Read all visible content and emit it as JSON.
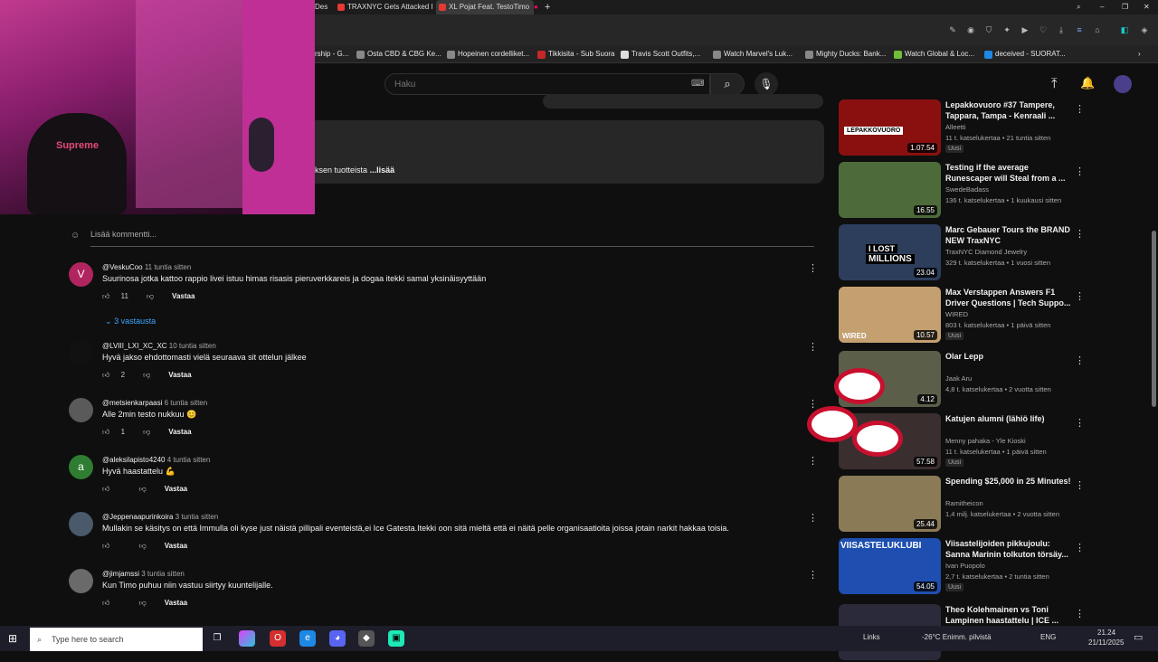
{
  "browser": {
    "tabs": [
      {
        "label": "Des"
      },
      {
        "label": "TRAXNYC Gets Attacked I"
      },
      {
        "label": "XL Pojat Feat. TestoTimo"
      }
    ],
    "bookmarks": [
      {
        "label": "rship - G..."
      },
      {
        "label": "Osta CBD & CBG Ke..."
      },
      {
        "label": "Hopeinen cordelliket..."
      },
      {
        "label": "Tikkisita - Sub Suora"
      },
      {
        "label": "Travis Scott Outfits,..."
      },
      {
        "label": "Watch Marvel's Luk..."
      },
      {
        "label": "Mighty Ducks: Bank..."
      },
      {
        "label": "Watch Global & Loc..."
      },
      {
        "label": "deceived - SUORAT..."
      }
    ]
  },
  "youtube": {
    "search_placeholder": "Haku",
    "description_snippet": "ksen tuotteista",
    "description_more": "...lisää",
    "add_comment_placeholder": "Lisää kommentti...",
    "replies_link": "3 vastausta",
    "reply_label": "Vastaa",
    "comments": [
      {
        "author": "@VeskuCoo",
        "time": "11 tuntia sitten",
        "text": "Suurinosa jotka kattoo rappio livei istuu himas risasis pieruverkkareis ja dogaa itekki samal yksinäisyyttään",
        "likes": "11",
        "avatar_letter": "V",
        "avatar_color": "#b0255f"
      },
      {
        "author": "@LVIII_LXI_XC_XC",
        "time": "10 tuntia sitten",
        "text": "Hyvä jakso ehdottomasti vielä seuraava sit ottelun jälkee",
        "likes": "2",
        "avatar_letter": "",
        "avatar_color": "#111111"
      },
      {
        "author": "@metsienkarpaasi",
        "time": "6 tuntia sitten",
        "text": "Alle 2min testo nukkuu 😊",
        "likes": "1",
        "avatar_letter": "",
        "avatar_color": "#5a5a5a"
      },
      {
        "author": "@aleksilapisto4240",
        "time": "4 tuntia sitten",
        "text": "Hyvä haastattelu 💪",
        "likes": "",
        "avatar_letter": "a",
        "avatar_color": "#2e7d32"
      },
      {
        "author": "@Jeppenaapurinkoira",
        "time": "3 tuntia sitten",
        "text": "Mullakin se käsitys on että Immulla oli kyse just näistä pillipali eventeistä,ei Ice Gatesta.Itekki oon sitä mieltä että ei näitä pelle organisaatioita joissa jotain narkit hakkaa toisia.",
        "likes": "",
        "avatar_letter": "",
        "avatar_color": "#4a5a6a"
      },
      {
        "author": "@jimjamssi",
        "time": "3 tuntia sitten",
        "text": "Kun Timo puhuu niin vastuu siirtyy kuuntelijalle.",
        "likes": "",
        "avatar_letter": "",
        "avatar_color": "#6a6a6a"
      }
    ]
  },
  "sidebar": {
    "videos": [
      {
        "title": "Lepakkovuoro #37 Tampere, Tappara, Tampa - Kenraali ...",
        "channel": "Alleetti",
        "meta": "11 t. katselukertaa • 21 tuntia sitten",
        "badge": "Uusi",
        "duration": "1.07.54",
        "thumb_color": "#8a1010"
      },
      {
        "title": "Testing if the average Runescaper will Steal from a ...",
        "channel": "SwedeBadass",
        "meta": "136 t. katselukertaa • 1 kuukausi sitten",
        "badge": "",
        "duration": "16.55",
        "thumb_color": "#4d6b3a"
      },
      {
        "title": "Marc Gebauer Tours the BRAND NEW TraxNYC",
        "channel": "TraxNYC Diamond Jewelry",
        "meta": "329 t. katselukertaa • 1 vuosi sitten",
        "badge": "",
        "duration": "23.04",
        "thumb_color": "#2c3e5c"
      },
      {
        "title": "Max Verstappen Answers F1 Driver Questions | Tech Suppo...",
        "channel": "WIRED",
        "meta": "803 t. katselukertaa • 1 päivä sitten",
        "badge": "Uusi",
        "duration": "10.57",
        "thumb_color": "#c4a070"
      },
      {
        "title": "Olar Lepp",
        "channel": "Jaak Aru",
        "meta": "4,8 t. katselukertaa • 2 vuotta sitten",
        "badge": "",
        "duration": "4.12",
        "thumb_color": "#5b5f4a"
      },
      {
        "title": "Katujen alumni (lähiö life)",
        "channel": "Menny pahaka - Yle Kioski",
        "meta": "11 t. katselukertaa • 1 päivä sitten",
        "badge": "Uusi",
        "duration": "57.58",
        "thumb_color": "#3a2e2e"
      },
      {
        "title": "Spending $25,000 in 25 Minutes!",
        "channel": "Ramitheicon",
        "meta": "1,4 milj. katselukertaa • 2 vuotta sitten",
        "badge": "",
        "duration": "25.44",
        "thumb_color": "#8a7a55"
      },
      {
        "title": "Viisastelijoiden pikkujoulu: Sanna Marinin tolkuton törsäy...",
        "channel": "Ivan Puopolo",
        "meta": "2,7 t. katselukertaa • 2 tuntia sitten",
        "badge": "Uusi",
        "duration": "54.05",
        "thumb_color": "#1e4fb0"
      },
      {
        "title": "Theo Kolehmainen vs Toni Lampinen haastattelu | ICE ...",
        "channel": "",
        "meta": "",
        "badge": "",
        "duration": "",
        "thumb_color": "#2a2a3a"
      }
    ],
    "thumb_overlay_text": [
      "LEPAKKOVUORO",
      "I LOST",
      "MILLIONS",
      "VIISASTELUKLUBI",
      "WIRED"
    ]
  },
  "taskbar": {
    "search_placeholder": "Type here to search",
    "links_label": "Links",
    "weather": "-26°C Enimm. pilvistä",
    "language": "ENG",
    "time": "21.24",
    "date": "21/11/2025"
  }
}
